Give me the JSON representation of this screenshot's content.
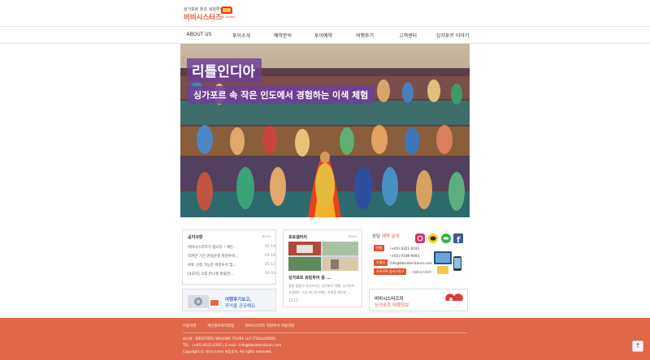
{
  "logo": {
    "tagline": "싱가포르 최초 워킹투어",
    "name": "비비시스터즈",
    "badge_text": "BB SISTERS"
  },
  "nav": [
    {
      "label": "ABOUT US"
    },
    {
      "label": "투어소개"
    },
    {
      "label": "예약문의"
    },
    {
      "label": "투어예약"
    },
    {
      "label": "여행후기"
    },
    {
      "label": "고객센터"
    },
    {
      "label": "싱가포르 이야기"
    }
  ],
  "hero": {
    "title": "리틀인디아",
    "subtitle": "싱가포르 속 작은 인도에서 경험하는 이색 체험"
  },
  "notice": {
    "title": "공지사항",
    "more": "more",
    "items": [
      {
        "text": "비비시스터즈가 옵니다 ! 개인...",
        "date": "05-19"
      },
      {
        "text": "리커만 기간 한정운영 워킹투어...",
        "date": "05-18"
      },
      {
        "text": "바로 신청 가능한 워킹투어 및...",
        "date": "05-12"
      },
      {
        "text": "[4호미] 오후 반나절 박물관...",
        "date": "04-03"
      }
    ]
  },
  "gallery": {
    "title": "포토갤러리",
    "more": "more",
    "post_title": "싱가포르 워킹투어 중 ...",
    "desc_lines": [
      "힐링 힐을이 다녀가시는 싱가포르 여행, 싱가포르",
      "고궁에는 그냥 자나가기에는 아쉬운 재미난 ...",
      "12-13"
    ]
  },
  "contact": {
    "title_prefix": "상담",
    "title_accent": "예약 문의",
    "rows": [
      {
        "button": "전화",
        "value": "(+65) 8321-6192"
      },
      {
        "button": "",
        "value": "(+65) 9109-9493"
      },
      {
        "button": "이메일",
        "value": "info@bbsisterstours.com"
      },
      {
        "button": "카카오톡 플러스친구",
        "value": "비비시스터즈"
      }
    ]
  },
  "banners": {
    "review_line1": "여행후기보고,",
    "review_line2": "추억을 공유해요.",
    "info_line1": "비비시스터즈의",
    "info_line2": "싱가포르 여행정보"
  },
  "footer": {
    "links": [
      "이용약관",
      "개인정보처리방침",
      "비비시스터즈 워킹투어 이용약관"
    ],
    "company": "회사명 : BBSISTERS WALKING TOURS LLP (T18LL0056G)",
    "contact": "TEL : (+65) 8321-6192  |  E-mail : info@bbsisterstours.com",
    "copyright": "Copyright © 비비시스터즈 워킹투어. All rights reserved."
  },
  "colors": {
    "accent": "#e0542e",
    "footer_bg": "#e0674a",
    "hero_label_bg": "#6e4096"
  },
  "icons": {
    "social": [
      "instagram-icon",
      "kakao-icon",
      "line-icon",
      "facebook-icon"
    ],
    "to_top": "arrow-up-icon"
  }
}
